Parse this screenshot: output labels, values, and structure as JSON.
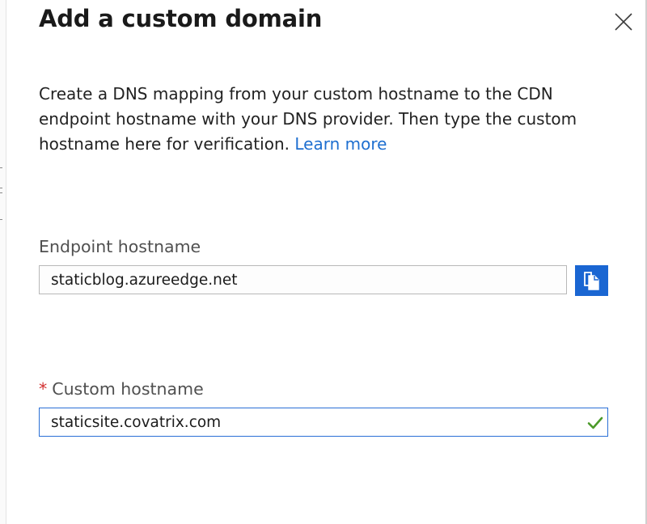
{
  "dialog": {
    "title": "Add a custom domain",
    "description": "Create a DNS mapping from your custom hostname to the CDN endpoint hostname with your DNS provider. Then type the custom hostname here for verification.",
    "learn_more_link": "Learn more",
    "close_icon": "close-icon"
  },
  "endpoint": {
    "label": "Endpoint hostname",
    "value": "staticblog.azureedge.net",
    "copy_icon": "copy-icon"
  },
  "custom": {
    "required_marker": "*",
    "label": "Custom hostname",
    "value": "staticsite.covatrix.com",
    "valid_icon": "checkmark-icon"
  },
  "colors": {
    "accent": "#1a66d2",
    "link": "#1e6fd0",
    "required": "#d22f2f",
    "valid": "#4c9a2a"
  }
}
